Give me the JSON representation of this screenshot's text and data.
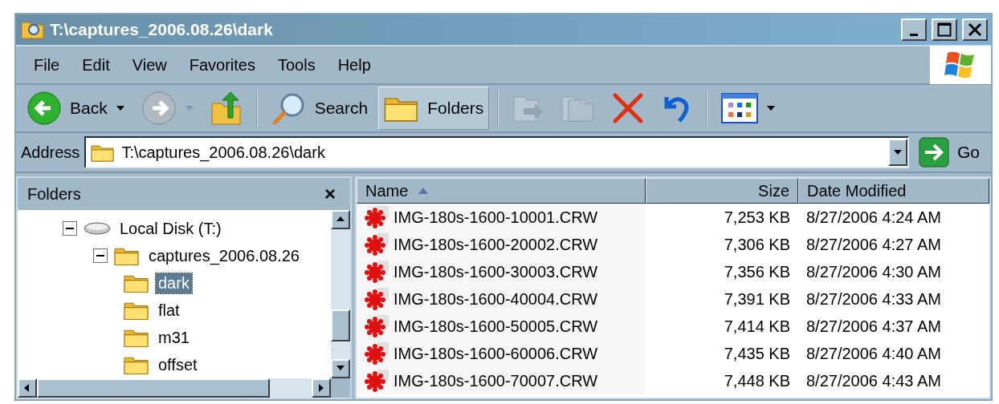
{
  "window": {
    "title": "T:\\captures_2006.08.26\\dark"
  },
  "menu": [
    "File",
    "Edit",
    "View",
    "Favorites",
    "Tools",
    "Help"
  ],
  "toolbar": {
    "back": {
      "label": "Back",
      "disabled": false
    },
    "forward": {
      "disabled": true
    },
    "search": {
      "label": "Search",
      "selected": false
    },
    "folders": {
      "label": "Folders",
      "selected": true
    },
    "move": {
      "disabled": true
    },
    "copy": {
      "disabled": true
    }
  },
  "address": {
    "label": "Address",
    "value": "T:\\captures_2006.08.26\\dark",
    "go": "Go"
  },
  "folders_pane": {
    "title": "Folders",
    "close": "×",
    "tree": [
      {
        "label": "Local Disk (T:)",
        "kind": "drive",
        "expanded": true,
        "selected": false,
        "children": [
          {
            "label": "captures_2006.08.26",
            "kind": "folder",
            "expanded": true,
            "selected": false,
            "children": [
              {
                "label": "dark",
                "kind": "folder",
                "selected": true
              },
              {
                "label": "flat",
                "kind": "folder",
                "selected": false
              },
              {
                "label": "m31",
                "kind": "folder",
                "selected": false
              },
              {
                "label": "offset",
                "kind": "folder",
                "selected": false
              }
            ]
          }
        ]
      }
    ]
  },
  "table": {
    "columns": [
      {
        "label": "Name",
        "sorted": true
      },
      {
        "label": "Size",
        "sorted": false
      },
      {
        "label": "Date Modified",
        "sorted": false
      }
    ],
    "rows": [
      [
        "IMG-180s-1600-10001.CRW",
        "7,253 KB",
        "8/27/2006 4:24 AM"
      ],
      [
        "IMG-180s-1600-20002.CRW",
        "7,306 KB",
        "8/27/2006 4:27 AM"
      ],
      [
        "IMG-180s-1600-30003.CRW",
        "7,356 KB",
        "8/27/2006 4:30 AM"
      ],
      [
        "IMG-180s-1600-40004.CRW",
        "7,391 KB",
        "8/27/2006 4:33 AM"
      ],
      [
        "IMG-180s-1600-50005.CRW",
        "7,414 KB",
        "8/27/2006 4:37 AM"
      ],
      [
        "IMG-180s-1600-60006.CRW",
        "7,435 KB",
        "8/27/2006 4:40 AM"
      ],
      [
        "IMG-180s-1600-70007.CRW",
        "7,448 KB",
        "8/27/2006 4:43 AM"
      ]
    ]
  }
}
